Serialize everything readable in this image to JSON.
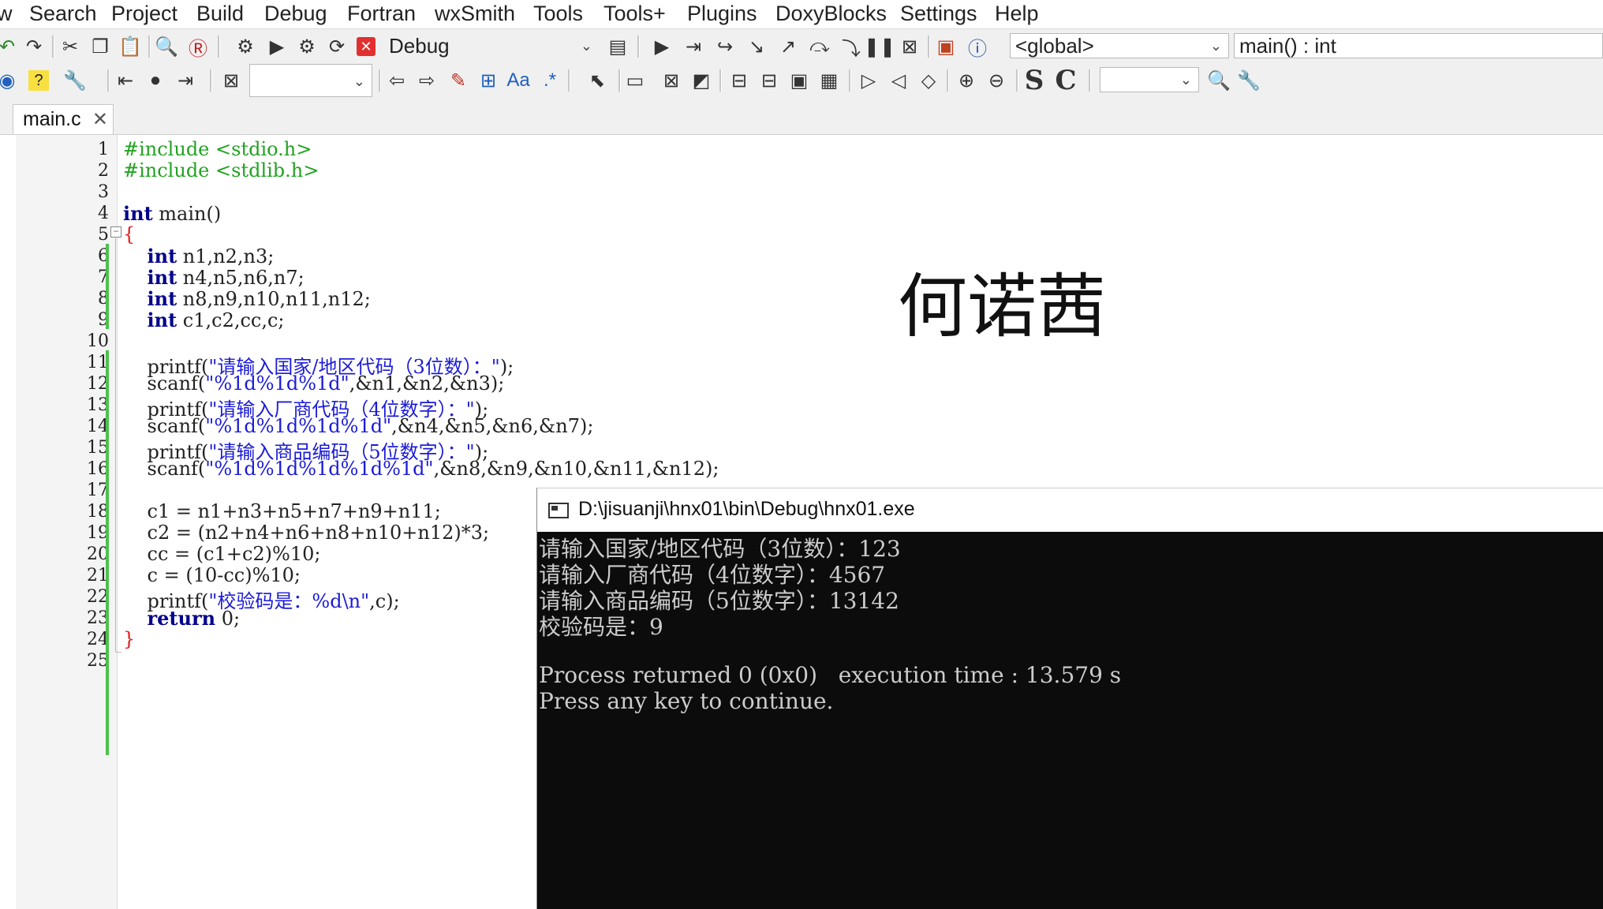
{
  "menu": [
    "w",
    "Search",
    "Project",
    "Build",
    "Debug",
    "Fortran",
    "wxSmith",
    "Tools",
    "Tools+",
    "Plugins",
    "DoxyBlocks",
    "Settings",
    "Help"
  ],
  "toolbar1": {
    "build_target": "Debug",
    "scope": "<global>",
    "function": "main() : int"
  },
  "toolbar2": {
    "search_value": "",
    "aa_label": "Aa",
    "regex_label": ".*",
    "s_label": "S",
    "c_label": "C",
    "zoom_value": ""
  },
  "tab": {
    "label": "main.c",
    "close": "✕"
  },
  "editor": {
    "line_numbers": [
      "1",
      "2",
      "3",
      "4",
      "5",
      "6",
      "7",
      "8",
      "9",
      "10",
      "11",
      "12",
      "13",
      "14",
      "15",
      "16",
      "17",
      "18",
      "19",
      "20",
      "21",
      "22",
      "23",
      "24",
      "25"
    ],
    "lines": [
      "#include <stdio.h>",
      "#include <stdlib.h>",
      "",
      "int main()",
      "{",
      "    int n1,n2,n3;",
      "    int n4,n5,n6,n7;",
      "    int n8,n9,n10,n11,n12;",
      "    int c1,c2,cc,c;",
      "",
      "    printf(\"请输入国家/地区代码（3位数）：\");",
      "    scanf(\"%1d%1d%1d\",&n1,&n2,&n3);",
      "    printf(\"请输入厂商代码（4位数字）：\");",
      "    scanf(\"%1d%1d%1d%1d\",&n4,&n5,&n6,&n7);",
      "    printf(\"请输入商品编码（5位数字）：\");",
      "    scanf(\"%1d%1d%1d%1d%1d\",&n8,&n9,&n10,&n11,&n12);",
      "",
      "    c1 = n1+n3+n5+n7+n9+n11;",
      "    c2 = (n2+n4+n6+n8+n10+n12)*3;",
      "    cc = (c1+c2)%10;",
      "    c = (10-cc)%10;",
      "    printf(\"校验码是：%d\\n\",c);",
      "    return 0;",
      "}",
      ""
    ]
  },
  "overlay_name": "何诺茜",
  "console": {
    "title": "D:\\jisuanji\\hnx01\\bin\\Debug\\hnx01.exe",
    "lines": [
      "请输入国家/地区代码（3位数）：123",
      "请输入厂商代码（4位数字）：4567",
      "请输入商品编码（5位数字）：13142",
      "校验码是：9",
      "",
      "Process returned 0 (0x0)   execution time : 13.579 s",
      "Press any key to continue."
    ]
  }
}
